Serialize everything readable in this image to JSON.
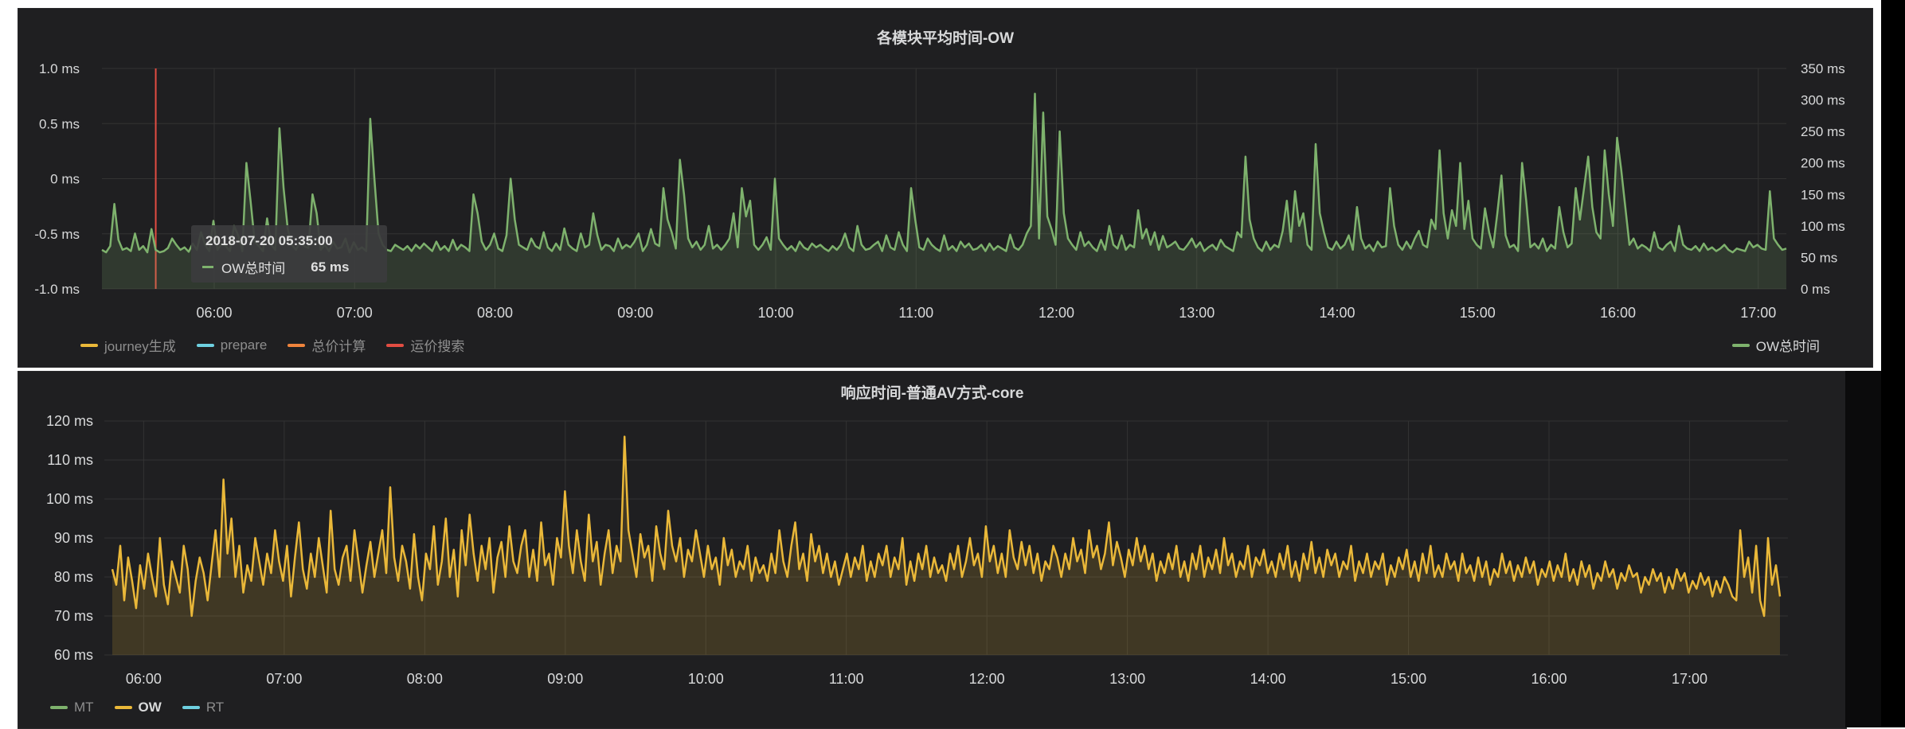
{
  "panel1": {
    "title": "各模块平均时间-OW",
    "tooltip": {
      "time": "2018-07-20 05:35:00",
      "series": "OW总时间",
      "value": "65 ms"
    },
    "legend_left": [
      {
        "label": "journey生成",
        "color": "#eab839"
      },
      {
        "label": "prepare",
        "color": "#6ed0e0"
      },
      {
        "label": "总价计算",
        "color": "#ef843c"
      },
      {
        "label": "运价搜索",
        "color": "#e24d42"
      }
    ],
    "legend_right": {
      "label": "OW总时间",
      "color": "#7eb26d"
    }
  },
  "panel2": {
    "title": "响应时间-普通AV方式-core",
    "legend": [
      {
        "label": "MT",
        "color": "#7eb26d",
        "bold": false
      },
      {
        "label": "OW",
        "color": "#eab839",
        "bold": true
      },
      {
        "label": "RT",
        "color": "#6ed0e0",
        "bold": false
      }
    ]
  },
  "chart_data": [
    {
      "type": "line",
      "title": "各模块平均时间-OW",
      "x_ticks": [
        "06:00",
        "07:00",
        "08:00",
        "09:00",
        "10:00",
        "11:00",
        "12:00",
        "13:00",
        "14:00",
        "15:00",
        "16:00",
        "17:00"
      ],
      "y_left_ticks": [
        "1.0 ms",
        "0.5 ms",
        "0 ms",
        "-0.5 ms",
        "-1.0 ms"
      ],
      "y_right_ticks": [
        "350 ms",
        "300 ms",
        "250 ms",
        "200 ms",
        "150 ms",
        "100 ms",
        "50 ms",
        "0 ms"
      ],
      "ylim_right": [
        0,
        350
      ],
      "xlim_hours": [
        5.2,
        17.2
      ],
      "marker_time": "05:35",
      "series": [
        {
          "name": "OW总时间",
          "color": "#7eb26d",
          "values": [
            62,
            58,
            68,
            135,
            78,
            62,
            65,
            60,
            88,
            62,
            68,
            58,
            95,
            62,
            58,
            60,
            65,
            80,
            70,
            62,
            66,
            59,
            72,
            62,
            90,
            70,
            60,
            108,
            62,
            72,
            68,
            60,
            100,
            85,
            60,
            200,
            140,
            75,
            68,
            60,
            112,
            70,
            62,
            255,
            160,
            95,
            70,
            62,
            75,
            68,
            65,
            150,
            120,
            62,
            70,
            60,
            75,
            64,
            66,
            80,
            58,
            74,
            62,
            66,
            60,
            270,
            175,
            88,
            70,
            62,
            60,
            70,
            66,
            62,
            68,
            60,
            70,
            64,
            72,
            66,
            60,
            75,
            62,
            68,
            60,
            78,
            62,
            70,
            66,
            60,
            150,
            120,
            75,
            62,
            70,
            88,
            64,
            60,
            85,
            175,
            110,
            70,
            66,
            62,
            80,
            68,
            64,
            90,
            66,
            60,
            72,
            62,
            96,
            70,
            64,
            60,
            88,
            66,
            70,
            120,
            85,
            62,
            70,
            68,
            60,
            80,
            64,
            70,
            66,
            75,
            88,
            60,
            70,
            95,
            72,
            68,
            160,
            110,
            90,
            64,
            205,
            150,
            80,
            66,
            75,
            62,
            70,
            100,
            64,
            70,
            62,
            70,
            80,
            120,
            66,
            160,
            115,
            140,
            70,
            62,
            70,
            82,
            62,
            175,
            80,
            70,
            62,
            68,
            60,
            75,
            66,
            62,
            72,
            66,
            70,
            64,
            60,
            68,
            62,
            70,
            88,
            66,
            60,
            100,
            70,
            62,
            64,
            70,
            75,
            60,
            85,
            66,
            62,
            90,
            70,
            60,
            160,
            110,
            66,
            62,
            80,
            70,
            64,
            60,
            85,
            62,
            68,
            60,
            75,
            66,
            72,
            62,
            64,
            70,
            60,
            72,
            62,
            68,
            64,
            60,
            86,
            66,
            62,
            70,
            88,
            100,
            310,
            80,
            280,
            115,
            95,
            70,
            250,
            120,
            80,
            70,
            62,
            90,
            68,
            75,
            66,
            60,
            78,
            62,
            100,
            70,
            64,
            85,
            62,
            70,
            66,
            125,
            80,
            95,
            70,
            90,
            62,
            84,
            66,
            70,
            75,
            64,
            62,
            70,
            80,
            66,
            74,
            60,
            66,
            70,
            62,
            78,
            68,
            64,
            60,
            90,
            82,
            210,
            110,
            80,
            66,
            60,
            75,
            62,
            70,
            66,
            92,
            140,
            75,
            155,
            100,
            120,
            70,
            62,
            230,
            120,
            90,
            66,
            62,
            75,
            64,
            70,
            85,
            62,
            130,
            80,
            64,
            70,
            60,
            75,
            66,
            68,
            160,
            100,
            70,
            62,
            75,
            64,
            80,
            92,
            70,
            66,
            110,
            95,
            220,
            120,
            80,
            125,
            100,
            200,
            95,
            140,
            80,
            70,
            64,
            128,
            90,
            66,
            120,
            180,
            85,
            66,
            70,
            60,
            200,
            140,
            66,
            72,
            64,
            80,
            60,
            70,
            64,
            130,
            90,
            66,
            72,
            160,
            110,
            160,
            210,
            130,
            90,
            80,
            220,
            150,
            100,
            240,
            190,
            130,
            70,
            80,
            64,
            70,
            66,
            60,
            90,
            66,
            62,
            70,
            75,
            60,
            100,
            70,
            64,
            62,
            68,
            60,
            72,
            62,
            66,
            60,
            64,
            70,
            62,
            58,
            64,
            62,
            60,
            75,
            66,
            70,
            64,
            62,
            155,
            80,
            70,
            62,
            64
          ]
        }
      ]
    },
    {
      "type": "line",
      "title": "响应时间-普通AV方式-core",
      "x_ticks": [
        "06:00",
        "07:00",
        "08:00",
        "09:00",
        "10:00",
        "11:00",
        "12:00",
        "13:00",
        "14:00",
        "15:00",
        "16:00",
        "17:00"
      ],
      "y_ticks": [
        "120 ms",
        "110 ms",
        "100 ms",
        "90 ms",
        "80 ms",
        "70 ms",
        "60 ms"
      ],
      "ylim": [
        60,
        120
      ],
      "xlim_hours": [
        5.72,
        17.7
      ],
      "series": [
        {
          "name": "OW",
          "color": "#eab839",
          "values": [
            82,
            78,
            88,
            74,
            85,
            79,
            72,
            83,
            77,
            86,
            80,
            75,
            90,
            78,
            73,
            84,
            80,
            76,
            88,
            82,
            70,
            79,
            85,
            81,
            74,
            83,
            92,
            80,
            105,
            86,
            95,
            80,
            88,
            76,
            83,
            79,
            90,
            84,
            78,
            86,
            81,
            92,
            84,
            79,
            88,
            75,
            85,
            94,
            82,
            77,
            86,
            80,
            90,
            83,
            76,
            97,
            82,
            78,
            85,
            88,
            79,
            92,
            84,
            76,
            83,
            89,
            80,
            86,
            92,
            81,
            103,
            85,
            79,
            88,
            84,
            77,
            91,
            80,
            74,
            86,
            82,
            93,
            78,
            84,
            95,
            80,
            87,
            75,
            92,
            83,
            96,
            86,
            79,
            88,
            82,
            90,
            76,
            85,
            89,
            80,
            93,
            84,
            81,
            88,
            92,
            80,
            87,
            79,
            94,
            83,
            86,
            78,
            90,
            85,
            102,
            88,
            81,
            92,
            84,
            79,
            96,
            84,
            89,
            78,
            86,
            92,
            81,
            88,
            84,
            116,
            92,
            86,
            80,
            91,
            85,
            88,
            79,
            93,
            86,
            82,
            97,
            88,
            84,
            90,
            80,
            87,
            84,
            92,
            86,
            80,
            88,
            82,
            85,
            78,
            90,
            83,
            87,
            80,
            84,
            82,
            88,
            79,
            85,
            81,
            83,
            79,
            86,
            81,
            92,
            84,
            80,
            88,
            94,
            82,
            86,
            79,
            91,
            84,
            88,
            81,
            86,
            80,
            84,
            78,
            82,
            86,
            80,
            85,
            82,
            88,
            79,
            84,
            80,
            86,
            83,
            88,
            80,
            85,
            82,
            90,
            78,
            84,
            79,
            86,
            82,
            88,
            80,
            85,
            81,
            83,
            79,
            86,
            82,
            88,
            80,
            84,
            90,
            83,
            86,
            80,
            93,
            84,
            88,
            81,
            86,
            80,
            92,
            85,
            82,
            89,
            83,
            88,
            81,
            86,
            79,
            84,
            82,
            88,
            85,
            80,
            86,
            82,
            90,
            84,
            87,
            81,
            92,
            85,
            88,
            82,
            86,
            94,
            83,
            89,
            85,
            80,
            87,
            83,
            90,
            84,
            88,
            82,
            86,
            79,
            84,
            81,
            86,
            82,
            88,
            80,
            84,
            79,
            86,
            82,
            88,
            80,
            85,
            82,
            87,
            81,
            90,
            83,
            86,
            80,
            84,
            82,
            88,
            80,
            85,
            83,
            87,
            81,
            84,
            80,
            86,
            82,
            88,
            80,
            84,
            79,
            86,
            82,
            89,
            81,
            85,
            80,
            87,
            83,
            86,
            80,
            84,
            82,
            88,
            79,
            84,
            81,
            86,
            80,
            84,
            82,
            86,
            78,
            83,
            80,
            85,
            82,
            87,
            80,
            84,
            79,
            86,
            81,
            88,
            80,
            83,
            80,
            86,
            82,
            84,
            79,
            86,
            81,
            83,
            79,
            85,
            80,
            84,
            78,
            82,
            80,
            86,
            81,
            84,
            79,
            83,
            80,
            85,
            81,
            84,
            78,
            82,
            80,
            84,
            79,
            83,
            80,
            86,
            79,
            82,
            78,
            84,
            80,
            83,
            77,
            81,
            79,
            84,
            80,
            82,
            77,
            81,
            79,
            83,
            80,
            81,
            76,
            80,
            78,
            82,
            79,
            81,
            76,
            80,
            77,
            82,
            79,
            81,
            76,
            79,
            77,
            81,
            78,
            80,
            75,
            79,
            76,
            80,
            78,
            75,
            74,
            92,
            80,
            85,
            76,
            88,
            74,
            70,
            90,
            78,
            83,
            75
          ]
        }
      ]
    }
  ]
}
